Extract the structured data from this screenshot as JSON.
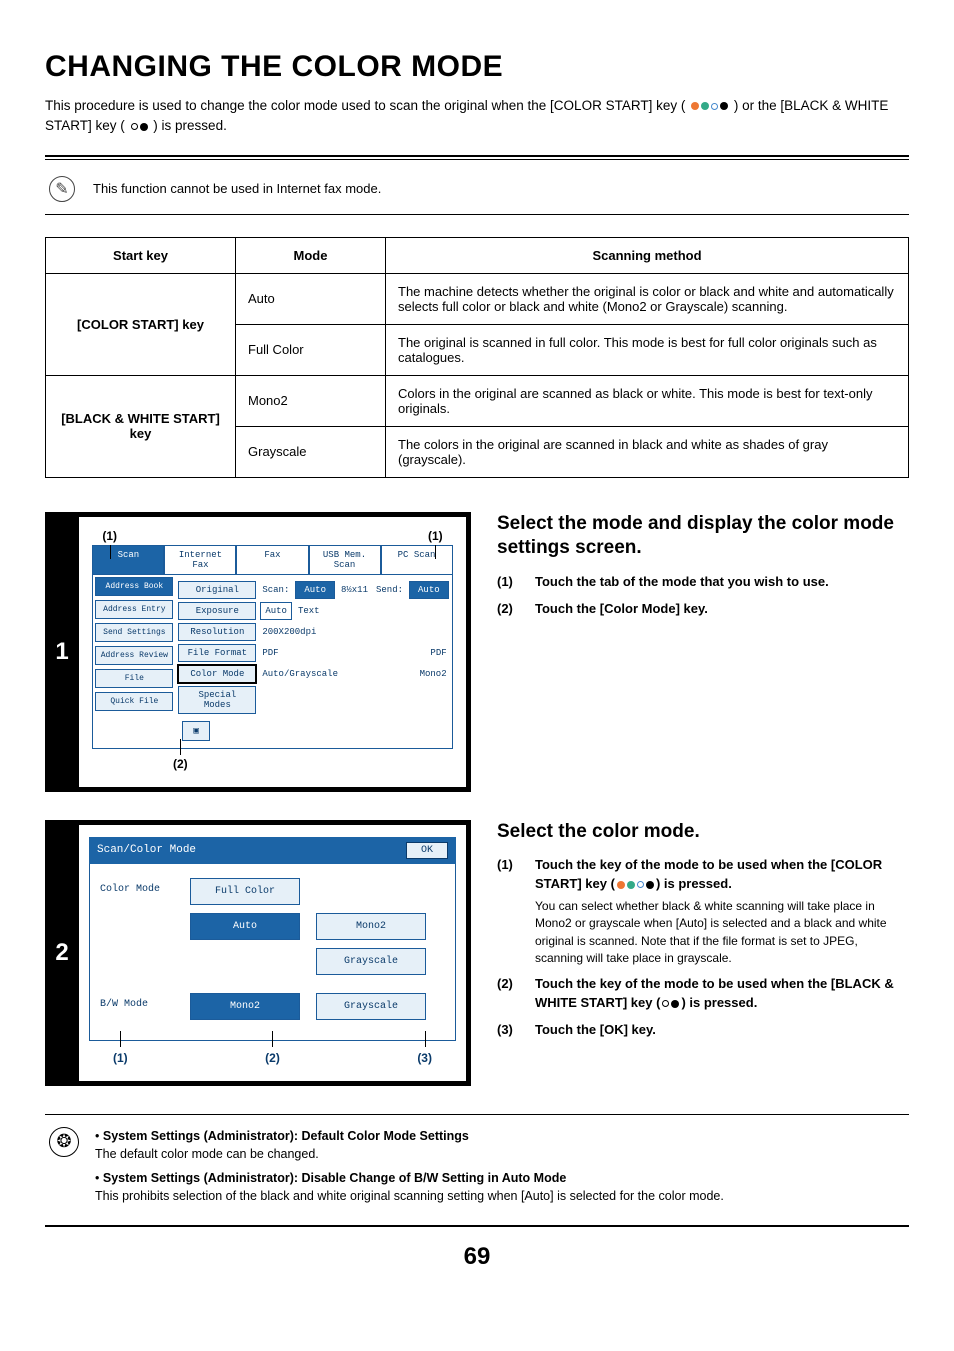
{
  "title": "CHANGING THE COLOR MODE",
  "intro_a": "This procedure is used to change the color mode used to scan the original when the [COLOR START] key (",
  "intro_b": ") or the [BLACK & WHITE START] key (",
  "intro_c": ") is pressed.",
  "note": "This function cannot be used in Internet fax mode.",
  "table": {
    "headers": [
      "Start key",
      "Mode",
      "Scanning method"
    ],
    "rows": [
      {
        "key": "[COLOR START] key",
        "mode": "Auto",
        "method": "The machine detects whether the original is color or black and white and automatically selects full color or black and white (Mono2 or Grayscale) scanning."
      },
      {
        "key": "",
        "mode": "Full Color",
        "method": "The original is scanned in full color. This mode is best for full color originals such as catalogues."
      },
      {
        "key": "[BLACK & WHITE START] key",
        "mode": "Mono2",
        "method": "Colors in the original are scanned as black or white. This mode is best for text-only originals."
      },
      {
        "key": "",
        "mode": "Grayscale",
        "method": "The colors in the original are scanned in black and white as shades of gray (grayscale)."
      }
    ]
  },
  "step1": {
    "num": "1",
    "callout_a": "(1)",
    "callout_b": "(1)",
    "callout_c": "(2)",
    "tabs": [
      "Scan",
      "Internet Fax",
      "Fax",
      "USB Mem. Scan",
      "PC Scan"
    ],
    "side": [
      "Address Book",
      "Address Entry",
      "Send Settings",
      "Address Review",
      "File",
      "Quick File"
    ],
    "rows": {
      "original_lbl": "Original",
      "original_txt": "Scan:",
      "original_auto": "Auto",
      "original_size": "8½x11",
      "original_send": "Send:",
      "original_send_val": "Auto",
      "exposure_lbl": "Exposure",
      "exposure_val": "Auto",
      "exposure_type": "Text",
      "resolution_lbl": "Resolution",
      "resolution_val": "200X200dpi",
      "fileformat_lbl": "File Format",
      "fileformat_val1": "PDF",
      "fileformat_val2": "PDF",
      "colormode_lbl": "Color Mode",
      "colormode_val1": "Auto/Grayscale",
      "colormode_val2": "Mono2",
      "special_lbl": "Special Modes"
    },
    "title": "Select the mode and display the color mode settings screen.",
    "items": [
      {
        "no": "(1)",
        "txt": "Touch the tab of the mode that you wish to use."
      },
      {
        "no": "(2)",
        "txt": "Touch the [Color Mode] key."
      }
    ]
  },
  "step2": {
    "num": "2",
    "header": "Scan/Color Mode",
    "ok": "OK",
    "color_label": "Color Mode",
    "color_opts": [
      "Full Color",
      "",
      "Auto",
      "Mono2",
      "",
      "Grayscale"
    ],
    "bw_label": "B/W Mode",
    "bw_opts": [
      "Mono2",
      "Grayscale"
    ],
    "callouts": [
      "(1)",
      "(2)",
      "(3)"
    ],
    "title": "Select the color mode.",
    "items": [
      {
        "no": "(1)",
        "bold": "Touch the key of the mode to be used when the [COLOR START] key (",
        "bold_tail": ") is pressed.",
        "sub": "You can select whether black & white scanning will take place in Mono2 or grayscale when [Auto] is selected and a black and white original is scanned. Note that if the file format is set to JPEG, scanning will take place in grayscale."
      },
      {
        "no": "(2)",
        "bold": "Touch the key of the mode to be used when the [BLACK & WHITE START] key (",
        "bold_tail": ") is pressed."
      },
      {
        "no": "(3)",
        "bold": "Touch the [OK] key."
      }
    ]
  },
  "sys": [
    {
      "title": "System Settings (Administrator): Default Color Mode Settings",
      "desc": "The default color mode can be changed."
    },
    {
      "title": "System Settings (Administrator): Disable Change of B/W Setting in Auto Mode",
      "desc": "This prohibits selection of the black and white original scanning setting when [Auto] is selected for the color mode."
    }
  ],
  "page": "69"
}
